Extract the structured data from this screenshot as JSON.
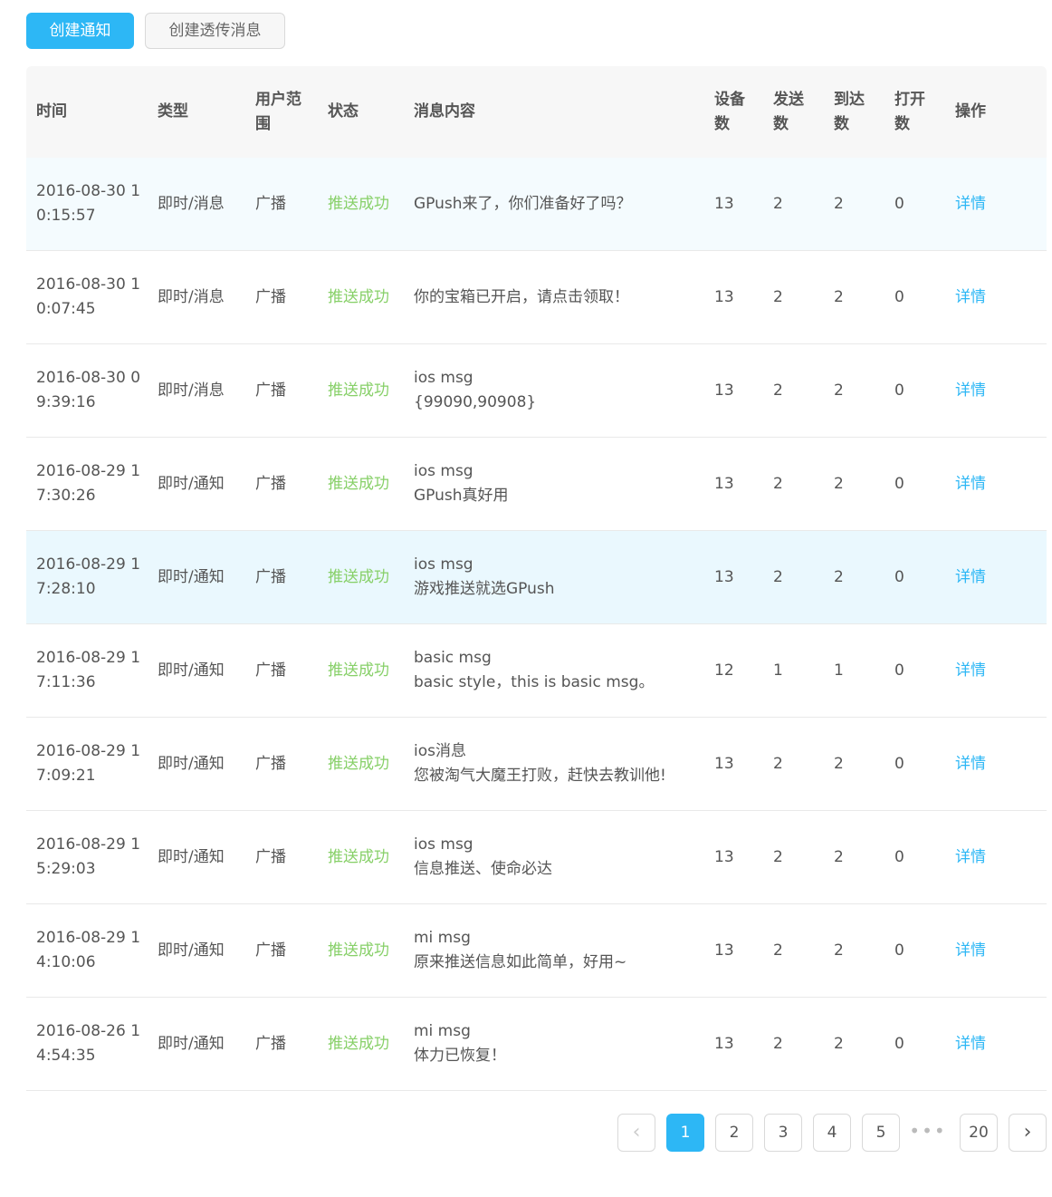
{
  "toolbar": {
    "create_notification": "创建通知",
    "create_passthrough": "创建透传消息"
  },
  "columns": {
    "time": "时间",
    "type": "类型",
    "scope_line1": "用户范",
    "scope_line2": "围",
    "status": "状态",
    "message": "消息内容",
    "devices_line1": "设备",
    "devices_line2": "数",
    "sent_line1": "发送",
    "sent_line2": "数",
    "arrived_line1": "到达",
    "arrived_line2": "数",
    "opened_line1": "打开",
    "opened_line2": "数",
    "action": "操作"
  },
  "rows": [
    {
      "time": "2016-08-30 10:15:57",
      "type": "即时/消息",
      "scope": "广播",
      "status": "推送成功",
      "msg1": "GPush来了，你们准备好了吗？",
      "msg2": "",
      "devices": "13",
      "sent": "2",
      "arrived": "2",
      "opened": "0",
      "action": "详情"
    },
    {
      "time": "2016-08-30 10:07:45",
      "type": "即时/消息",
      "scope": "广播",
      "status": "推送成功",
      "msg1": "你的宝箱已开启，请点击领取！",
      "msg2": "",
      "devices": "13",
      "sent": "2",
      "arrived": "2",
      "opened": "0",
      "action": "详情"
    },
    {
      "time": "2016-08-30 09:39:16",
      "type": "即时/消息",
      "scope": "广播",
      "status": "推送成功",
      "msg1": "ios msg",
      "msg2": "{99090,90908}",
      "devices": "13",
      "sent": "2",
      "arrived": "2",
      "opened": "0",
      "action": "详情"
    },
    {
      "time": "2016-08-29 17:30:26",
      "type": "即时/通知",
      "scope": "广播",
      "status": "推送成功",
      "msg1": "ios msg",
      "msg2": "GPush真好用",
      "devices": "13",
      "sent": "2",
      "arrived": "2",
      "opened": "0",
      "action": "详情"
    },
    {
      "time": "2016-08-29 17:28:10",
      "type": "即时/通知",
      "scope": "广播",
      "status": "推送成功",
      "msg1": "ios msg",
      "msg2": "游戏推送就选GPush",
      "devices": "13",
      "sent": "2",
      "arrived": "2",
      "opened": "0",
      "action": "详情"
    },
    {
      "time": "2016-08-29 17:11:36",
      "type": "即时/通知",
      "scope": "广播",
      "status": "推送成功",
      "msg1": "basic msg",
      "msg2": "basic style，this is basic msg。",
      "devices": "12",
      "sent": "1",
      "arrived": "1",
      "opened": "0",
      "action": "详情"
    },
    {
      "time": "2016-08-29 17:09:21",
      "type": "即时/通知",
      "scope": "广播",
      "status": "推送成功",
      "msg1": "ios消息",
      "msg2": "您被淘气大魔王打败，赶快去教训他!",
      "devices": "13",
      "sent": "2",
      "arrived": "2",
      "opened": "0",
      "action": "详情"
    },
    {
      "time": "2016-08-29 15:29:03",
      "type": "即时/通知",
      "scope": "广播",
      "status": "推送成功",
      "msg1": "ios msg",
      "msg2": "信息推送、使命必达",
      "devices": "13",
      "sent": "2",
      "arrived": "2",
      "opened": "0",
      "action": "详情"
    },
    {
      "time": "2016-08-29 14:10:06",
      "type": "即时/通知",
      "scope": "广播",
      "status": "推送成功",
      "msg1": "mi msg",
      "msg2": "原来推送信息如此简单，好用~",
      "devices": "13",
      "sent": "2",
      "arrived": "2",
      "opened": "0",
      "action": "详情"
    },
    {
      "time": "2016-08-26 14:54:35",
      "type": "即时/通知",
      "scope": "广播",
      "status": "推送成功",
      "msg1": "mi msg",
      "msg2": "体力已恢复！",
      "devices": "13",
      "sent": "2",
      "arrived": "2",
      "opened": "0",
      "action": "详情"
    }
  ],
  "pagination": {
    "prev_icon": "chevron-left-icon",
    "next_icon": "chevron-right-icon",
    "prev_glyph": "‹",
    "next_glyph": "›",
    "pages": [
      "1",
      "2",
      "3",
      "4",
      "5"
    ],
    "current": "1",
    "ellipsis": "•••",
    "last": "20"
  },
  "colors": {
    "primary": "#2db7f5",
    "success": "#87d068",
    "header_bg": "#f7f7f7",
    "row_highlight": "#eaf8fe"
  }
}
